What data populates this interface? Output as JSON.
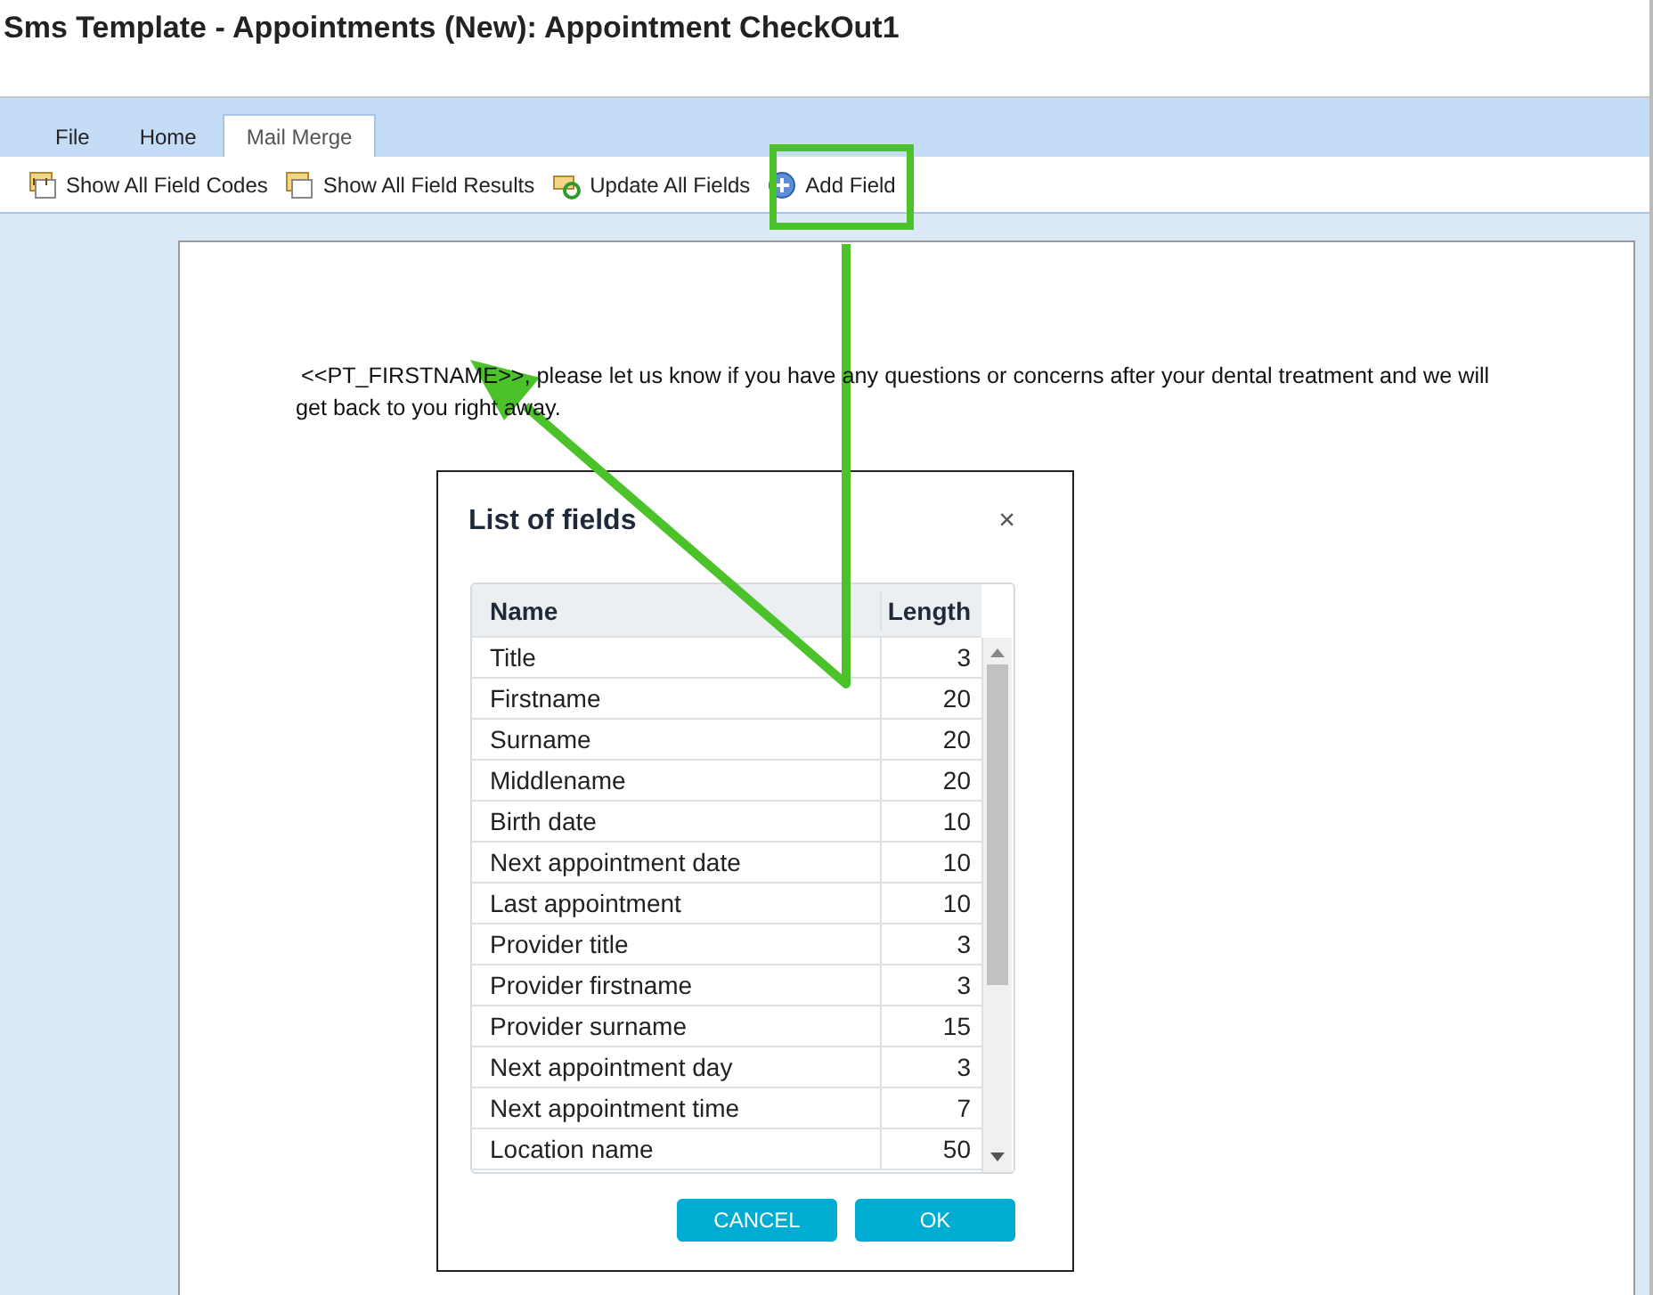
{
  "window": {
    "title": "Sms Template - Appointments (New): Appointment CheckOut1"
  },
  "tabs": [
    {
      "label": "File",
      "selected": false
    },
    {
      "label": "Home",
      "selected": false
    },
    {
      "label": "Mail Merge",
      "selected": true
    }
  ],
  "toolbar": [
    {
      "label": "Show All Field Codes",
      "kind": "codes"
    },
    {
      "label": "Show All Field Results",
      "kind": "results"
    },
    {
      "label": "Update All Fields",
      "kind": "update"
    },
    {
      "label": "Add Field",
      "kind": "add"
    }
  ],
  "document": {
    "paragraph": "<<PT_FIRSTNAME>>, please let us know if you have any questions or concerns after your dental treatment and we will get back to you right away."
  },
  "dialog": {
    "title": "List of fields",
    "close": "×",
    "columns": [
      "Name",
      "Length"
    ],
    "rows": [
      {
        "name": "Title",
        "length": "3"
      },
      {
        "name": "Firstname",
        "length": "20"
      },
      {
        "name": "Surname",
        "length": "20"
      },
      {
        "name": "Middlename",
        "length": "20"
      },
      {
        "name": "Birth date",
        "length": "10"
      },
      {
        "name": "Next appointment date",
        "length": "10"
      },
      {
        "name": "Last appointment",
        "length": "10"
      },
      {
        "name": "Provider title",
        "length": "3"
      },
      {
        "name": "Provider firstname",
        "length": "3"
      },
      {
        "name": "Provider surname",
        "length": "15"
      },
      {
        "name": "Next appointment day",
        "length": "3"
      },
      {
        "name": "Next appointment time",
        "length": "7"
      },
      {
        "name": "Location name",
        "length": "50"
      }
    ],
    "buttons": [
      "CANCEL",
      "OK"
    ]
  }
}
